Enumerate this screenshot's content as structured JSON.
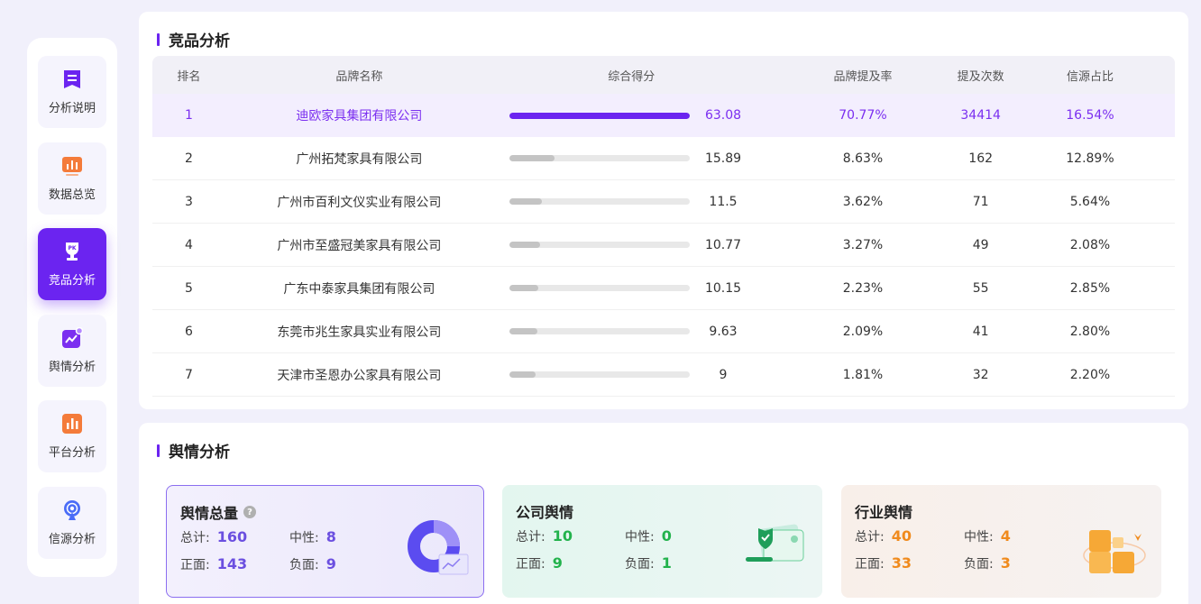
{
  "sidebar": {
    "items": [
      {
        "label": "分析说明",
        "icon": "document-icon",
        "active": false
      },
      {
        "label": "数据总览",
        "icon": "bar-chart-icon",
        "active": false
      },
      {
        "label": "竞品分析",
        "icon": "trophy-icon",
        "active": true
      },
      {
        "label": "舆情分析",
        "icon": "trend-icon",
        "active": false
      },
      {
        "label": "平台分析",
        "icon": "platform-chart-icon",
        "active": false
      },
      {
        "label": "信源分析",
        "icon": "broadcast-icon",
        "active": false
      }
    ]
  },
  "competitor": {
    "title": "竞品分析",
    "headers": {
      "rank": "排名",
      "brand": "品牌名称",
      "score": "综合得分",
      "mention_rate": "品牌提及率",
      "mention_count": "提及次数",
      "source_share": "信源占比"
    },
    "rows": [
      {
        "rank": "1",
        "brand": "迪欧家具集团有限公司",
        "score": "63.08",
        "score_value": 63.08,
        "mention_rate": "70.77%",
        "mention_count": "34414",
        "source_share": "16.54%"
      },
      {
        "rank": "2",
        "brand": "广州拓梵家具有限公司",
        "score": "15.89",
        "score_value": 15.89,
        "mention_rate": "8.63%",
        "mention_count": "162",
        "source_share": "12.89%"
      },
      {
        "rank": "3",
        "brand": "广州市百利文仪实业有限公司",
        "score": "11.5",
        "score_value": 11.5,
        "mention_rate": "3.62%",
        "mention_count": "71",
        "source_share": "5.64%"
      },
      {
        "rank": "4",
        "brand": "广州市至盛冠美家具有限公司",
        "score": "10.77",
        "score_value": 10.77,
        "mention_rate": "3.27%",
        "mention_count": "49",
        "source_share": "2.08%"
      },
      {
        "rank": "5",
        "brand": "广东中泰家具集团有限公司",
        "score": "10.15",
        "score_value": 10.15,
        "mention_rate": "2.23%",
        "mention_count": "55",
        "source_share": "2.85%"
      },
      {
        "rank": "6",
        "brand": "东莞市兆生家具实业有限公司",
        "score": "9.63",
        "score_value": 9.63,
        "mention_rate": "2.09%",
        "mention_count": "41",
        "source_share": "2.80%"
      },
      {
        "rank": "7",
        "brand": "天津市圣恩办公家具有限公司",
        "score": "9",
        "score_value": 9,
        "mention_rate": "1.81%",
        "mention_count": "32",
        "source_share": "2.20%"
      }
    ]
  },
  "sentiment": {
    "title": "舆情分析",
    "cards": {
      "total": {
        "title": "舆情总量",
        "help_icon": "question-icon",
        "total_label": "总计:",
        "total": "160",
        "neutral_label": "中性:",
        "neutral": "8",
        "positive_label": "正面:",
        "positive": "143",
        "negative_label": "负面:",
        "negative": "9",
        "color": "#6b4fe0"
      },
      "company": {
        "title": "公司舆情",
        "total_label": "总计:",
        "total": "10",
        "neutral_label": "中性:",
        "neutral": "0",
        "positive_label": "正面:",
        "positive": "9",
        "negative_label": "负面:",
        "negative": "1",
        "color": "#22b24c"
      },
      "industry": {
        "title": "行业舆情",
        "total_label": "总计:",
        "total": "40",
        "neutral_label": "中性:",
        "neutral": "4",
        "positive_label": "正面:",
        "positive": "33",
        "negative_label": "负面:",
        "negative": "3",
        "color": "#f08a1c"
      }
    }
  },
  "colors": {
    "accent": "#6b24f0",
    "background": "#f1f0fb"
  }
}
